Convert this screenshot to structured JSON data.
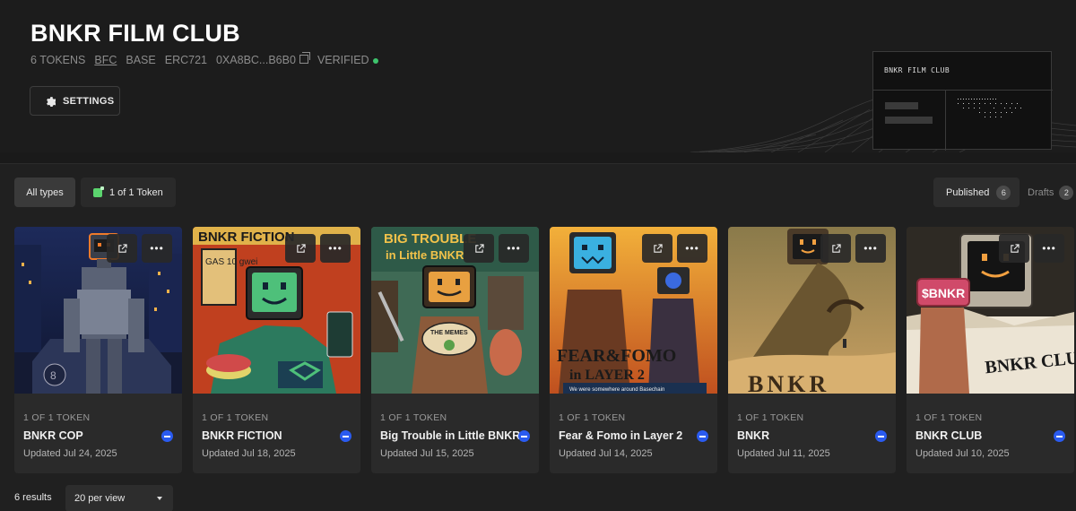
{
  "collection": {
    "title": "BNKR FILM CLUB",
    "tokens": "6 TOKENS",
    "symbol": "BFC",
    "chain": "BASE",
    "standard": "ERC721",
    "address": "0XA8BC...B6B0",
    "verified": "VERIFIED",
    "settings_label": "SETTINGS",
    "logo_text": "BNKR FILM CLUB"
  },
  "filters": {
    "all_types": "All types",
    "one_of_one": "1 of 1 Token"
  },
  "tabs": {
    "published": "Published",
    "published_count": "6",
    "drafts": "Drafts",
    "drafts_count": "2"
  },
  "cards": [
    {
      "kind": "1 OF 1 TOKEN",
      "name": "BNKR COP",
      "updated": "Updated Jul 24, 2025"
    },
    {
      "kind": "1 OF 1 TOKEN",
      "name": "BNKR FICTION",
      "updated": "Updated Jul 18, 2025"
    },
    {
      "kind": "1 OF 1 TOKEN",
      "name": "Big Trouble in Little BNKR",
      "updated": "Updated Jul 15, 2025"
    },
    {
      "kind": "1 OF 1 TOKEN",
      "name": "Fear & Fomo in Layer 2",
      "updated": "Updated Jul 14, 2025"
    },
    {
      "kind": "1 OF 1 TOKEN",
      "name": "BNKR",
      "updated": "Updated Jul 11, 2025"
    },
    {
      "kind": "1 OF 1 TOKEN",
      "name": "BNKR CLUB",
      "updated": "Updated Jul 10, 2025"
    }
  ],
  "art": {
    "fiction_top": "BNKR FICTION",
    "fiction_sign": "GAS 10 gwei",
    "trouble_top": "BIG TROUBLE",
    "trouble_sub": "in Little BNKR",
    "trouble_memes": "THE MEMES",
    "fear_title": "FEAR&FOMO",
    "fear_sub": "in LAYER 2",
    "fear_tag": "We were somewhere around Basechain",
    "bnkr_title": "BNKR",
    "club_sign": "$BNKR",
    "club_title": "BNKR CLUB"
  },
  "pagination": {
    "results": "6 results",
    "per_view": "20 per view"
  }
}
